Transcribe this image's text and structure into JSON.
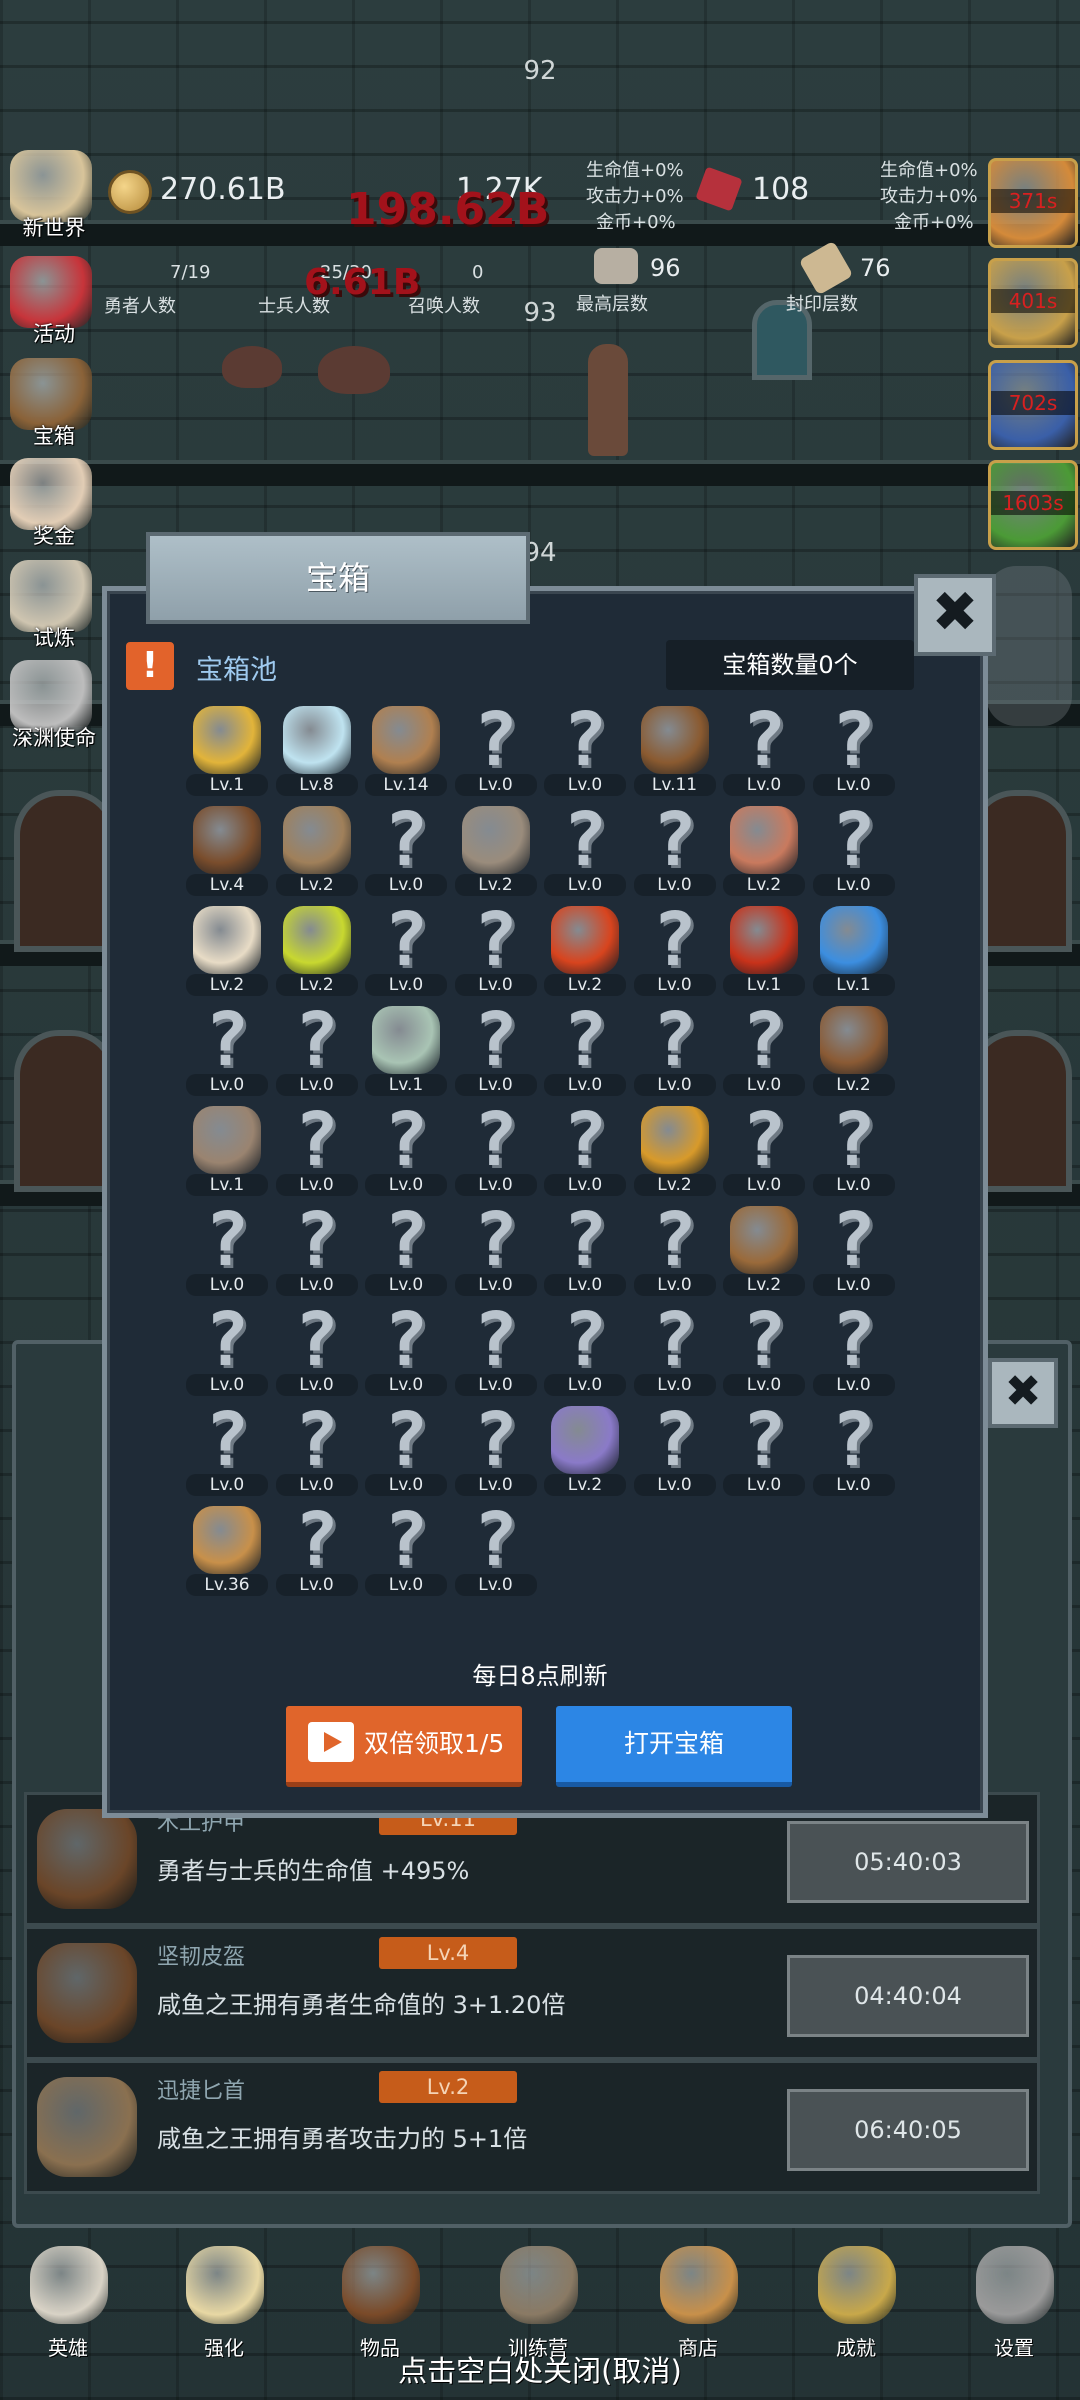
{
  "floors": {
    "f92": "92",
    "f93": "93",
    "f94": "94"
  },
  "hud": {
    "gold": "270.61B",
    "meat_value": "1.27K",
    "gem": "108",
    "bonus_left": {
      "hp": "生命值+0%",
      "atk": "攻击力+0%",
      "gold": "金币+0%"
    },
    "bonus_right": {
      "hp": "生命值+0%",
      "atk": "攻击力+0%",
      "gold": "金币+0%"
    },
    "hero_count": "7/19",
    "hero_label": "勇者人数",
    "soldier_count": "25/30",
    "soldier_label": "士兵人数",
    "summon_count": "0",
    "summon_label": "召唤人数",
    "max_floor": "96",
    "max_floor_label": "最高层数",
    "seal_floor": "76",
    "seal_floor_label": "封印层数",
    "damage_big": "198.62B",
    "damage_small": "6.61B"
  },
  "left_menu": [
    {
      "label": "新世界",
      "icon": "map-icon",
      "color": "#d8c49a"
    },
    {
      "label": "活动",
      "icon": "heart-icon",
      "color": "#c7343a"
    },
    {
      "label": "宝箱",
      "icon": "chest-icon",
      "color": "#8a6238"
    },
    {
      "label": "奖金",
      "icon": "envelope-icon",
      "color": "#e2cdb5"
    },
    {
      "label": "试炼",
      "icon": "horn-icon",
      "color": "#cfc5b0"
    },
    {
      "label": "深渊使命",
      "icon": "orb-icon",
      "color": "#bdbdbd"
    }
  ],
  "right_timers": [
    {
      "time": "371s",
      "color": "#d48a3a"
    },
    {
      "time": "401s",
      "color": "#c8a04a"
    },
    {
      "time": "702s",
      "color": "#3a5fa8"
    },
    {
      "time": "1603s",
      "color": "#4b9a36"
    }
  ],
  "modal": {
    "title": "宝箱",
    "close": "✖",
    "pool_label": "宝箱池",
    "count_label": "宝箱数量0个",
    "refresh_text": "每日8点刷新",
    "double_button": "双倍领取1/5",
    "open_button": "打开宝箱",
    "items": [
      {
        "lv": "Lv.1",
        "icon": "crown-icon",
        "color": "#e2b43a"
      },
      {
        "lv": "Lv.8",
        "icon": "diamond-icon",
        "color": "#bfe3f0"
      },
      {
        "lv": "Lv.14",
        "icon": "sword-icon",
        "color": "#b08050"
      },
      {
        "lv": "Lv.0",
        "icon": "unknown-icon"
      },
      {
        "lv": "Lv.0",
        "icon": "unknown-icon"
      },
      {
        "lv": "Lv.11",
        "icon": "armor-icon",
        "color": "#8a5a30"
      },
      {
        "lv": "Lv.0",
        "icon": "unknown-icon"
      },
      {
        "lv": "Lv.0",
        "icon": "unknown-icon"
      },
      {
        "lv": "Lv.4",
        "icon": "leather-helmet-icon",
        "color": "#7a4d2c"
      },
      {
        "lv": "Lv.2",
        "icon": "dagger-icon",
        "color": "#a0805a"
      },
      {
        "lv": "Lv.0",
        "icon": "unknown-icon"
      },
      {
        "lv": "Lv.2",
        "icon": "hammer-icon",
        "color": "#9a8c7c"
      },
      {
        "lv": "Lv.0",
        "icon": "unknown-icon"
      },
      {
        "lv": "Lv.0",
        "icon": "unknown-icon"
      },
      {
        "lv": "Lv.2",
        "icon": "meat-icon",
        "color": "#c97a5e"
      },
      {
        "lv": "Lv.0",
        "icon": "unknown-icon"
      },
      {
        "lv": "Lv.2",
        "icon": "bowl-icon",
        "color": "#e8dcc6"
      },
      {
        "lv": "Lv.2",
        "icon": "yellow-potion-icon",
        "color": "#c8d830"
      },
      {
        "lv": "Lv.0",
        "icon": "unknown-icon"
      },
      {
        "lv": "Lv.0",
        "icon": "unknown-icon"
      },
      {
        "lv": "Lv.2",
        "icon": "red-potion-icon",
        "color": "#d8441e"
      },
      {
        "lv": "Lv.0",
        "icon": "unknown-icon"
      },
      {
        "lv": "Lv.1",
        "icon": "big-red-potion-icon",
        "color": "#c8321a"
      },
      {
        "lv": "Lv.1",
        "icon": "blue-potion-icon",
        "color": "#3c8ee0"
      },
      {
        "lv": "Lv.0",
        "icon": "unknown-icon"
      },
      {
        "lv": "Lv.0",
        "icon": "unknown-icon"
      },
      {
        "lv": "Lv.1",
        "icon": "empty-bottle-icon",
        "color": "#a9c4b4"
      },
      {
        "lv": "Lv.0",
        "icon": "unknown-icon"
      },
      {
        "lv": "Lv.0",
        "icon": "unknown-icon"
      },
      {
        "lv": "Lv.0",
        "icon": "unknown-icon"
      },
      {
        "lv": "Lv.0",
        "icon": "unknown-icon"
      },
      {
        "lv": "Lv.2",
        "icon": "boot-icon",
        "color": "#8a5a34"
      },
      {
        "lv": "Lv.1",
        "icon": "shoe-icon",
        "color": "#9a8470"
      },
      {
        "lv": "Lv.0",
        "icon": "unknown-icon"
      },
      {
        "lv": "Lv.0",
        "icon": "unknown-icon"
      },
      {
        "lv": "Lv.0",
        "icon": "unknown-icon"
      },
      {
        "lv": "Lv.0",
        "icon": "unknown-icon"
      },
      {
        "lv": "Lv.2",
        "icon": "torch-icon",
        "color": "#d89a2a"
      },
      {
        "lv": "Lv.0",
        "icon": "unknown-icon"
      },
      {
        "lv": "Lv.0",
        "icon": "unknown-icon"
      },
      {
        "lv": "Lv.0",
        "icon": "unknown-icon"
      },
      {
        "lv": "Lv.0",
        "icon": "unknown-icon"
      },
      {
        "lv": "Lv.0",
        "icon": "unknown-icon"
      },
      {
        "lv": "Lv.0",
        "icon": "unknown-icon"
      },
      {
        "lv": "Lv.0",
        "icon": "unknown-icon"
      },
      {
        "lv": "Lv.0",
        "icon": "unknown-icon"
      },
      {
        "lv": "Lv.2",
        "icon": "backpack-icon",
        "color": "#9a6a3a"
      },
      {
        "lv": "Lv.0",
        "icon": "unknown-icon"
      },
      {
        "lv": "Lv.0",
        "icon": "unknown-icon"
      },
      {
        "lv": "Lv.0",
        "icon": "unknown-icon"
      },
      {
        "lv": "Lv.0",
        "icon": "unknown-icon"
      },
      {
        "lv": "Lv.0",
        "icon": "unknown-icon"
      },
      {
        "lv": "Lv.0",
        "icon": "unknown-icon"
      },
      {
        "lv": "Lv.0",
        "icon": "unknown-icon"
      },
      {
        "lv": "Lv.0",
        "icon": "unknown-icon"
      },
      {
        "lv": "Lv.0",
        "icon": "unknown-icon"
      },
      {
        "lv": "Lv.0",
        "icon": "unknown-icon"
      },
      {
        "lv": "Lv.0",
        "icon": "unknown-icon"
      },
      {
        "lv": "Lv.0",
        "icon": "unknown-icon"
      },
      {
        "lv": "Lv.0",
        "icon": "unknown-icon"
      },
      {
        "lv": "Lv.2",
        "icon": "monster-icon",
        "color": "#8a7ac8"
      },
      {
        "lv": "Lv.0",
        "icon": "unknown-icon"
      },
      {
        "lv": "Lv.0",
        "icon": "unknown-icon"
      },
      {
        "lv": "Lv.0",
        "icon": "unknown-icon"
      },
      {
        "lv": "Lv.36",
        "icon": "beer-mug-icon",
        "color": "#c8904a"
      },
      {
        "lv": "Lv.0",
        "icon": "unknown-icon"
      },
      {
        "lv": "Lv.0",
        "icon": "unknown-icon"
      },
      {
        "lv": "Lv.0",
        "icon": "unknown-icon"
      }
    ]
  },
  "list_rows": [
    {
      "name": "木工护甲",
      "lv": "Lv.11",
      "desc": "勇者与士兵的生命值 +495%",
      "timer": "05:40:03",
      "icon": "armor-icon",
      "color": "#6a4528"
    },
    {
      "name": "坚韧皮盔",
      "lv": "Lv.4",
      "desc": "咸鱼之王拥有勇者生命值的 3+1.20倍",
      "timer": "04:40:04",
      "icon": "leather-helmet-icon",
      "color": "#6a4528"
    },
    {
      "name": "迅捷匕首",
      "lv": "Lv.2",
      "desc": "咸鱼之王拥有勇者攻击力的 5+1倍",
      "timer": "06:40:05",
      "icon": "dagger-icon",
      "color": "#8a7050"
    }
  ],
  "bottom_nav": [
    {
      "label": "英雄",
      "icon": "skull-icon",
      "color": "#d9d3c6"
    },
    {
      "label": "强化",
      "icon": "candle-icon",
      "color": "#e8d8a4"
    },
    {
      "label": "物品",
      "icon": "book-icon",
      "color": "#7a4a28"
    },
    {
      "label": "训练营",
      "icon": "lantern-icon",
      "color": "#8a7a64"
    },
    {
      "label": "商店",
      "icon": "beer-mug-icon",
      "color": "#c8904a"
    },
    {
      "label": "成就",
      "icon": "key-icon",
      "color": "#c8a84a"
    },
    {
      "label": "设置",
      "icon": "gear-icon",
      "color": "#9a9a9a"
    }
  ],
  "footer_text": "点击空白处关闭(取消)"
}
